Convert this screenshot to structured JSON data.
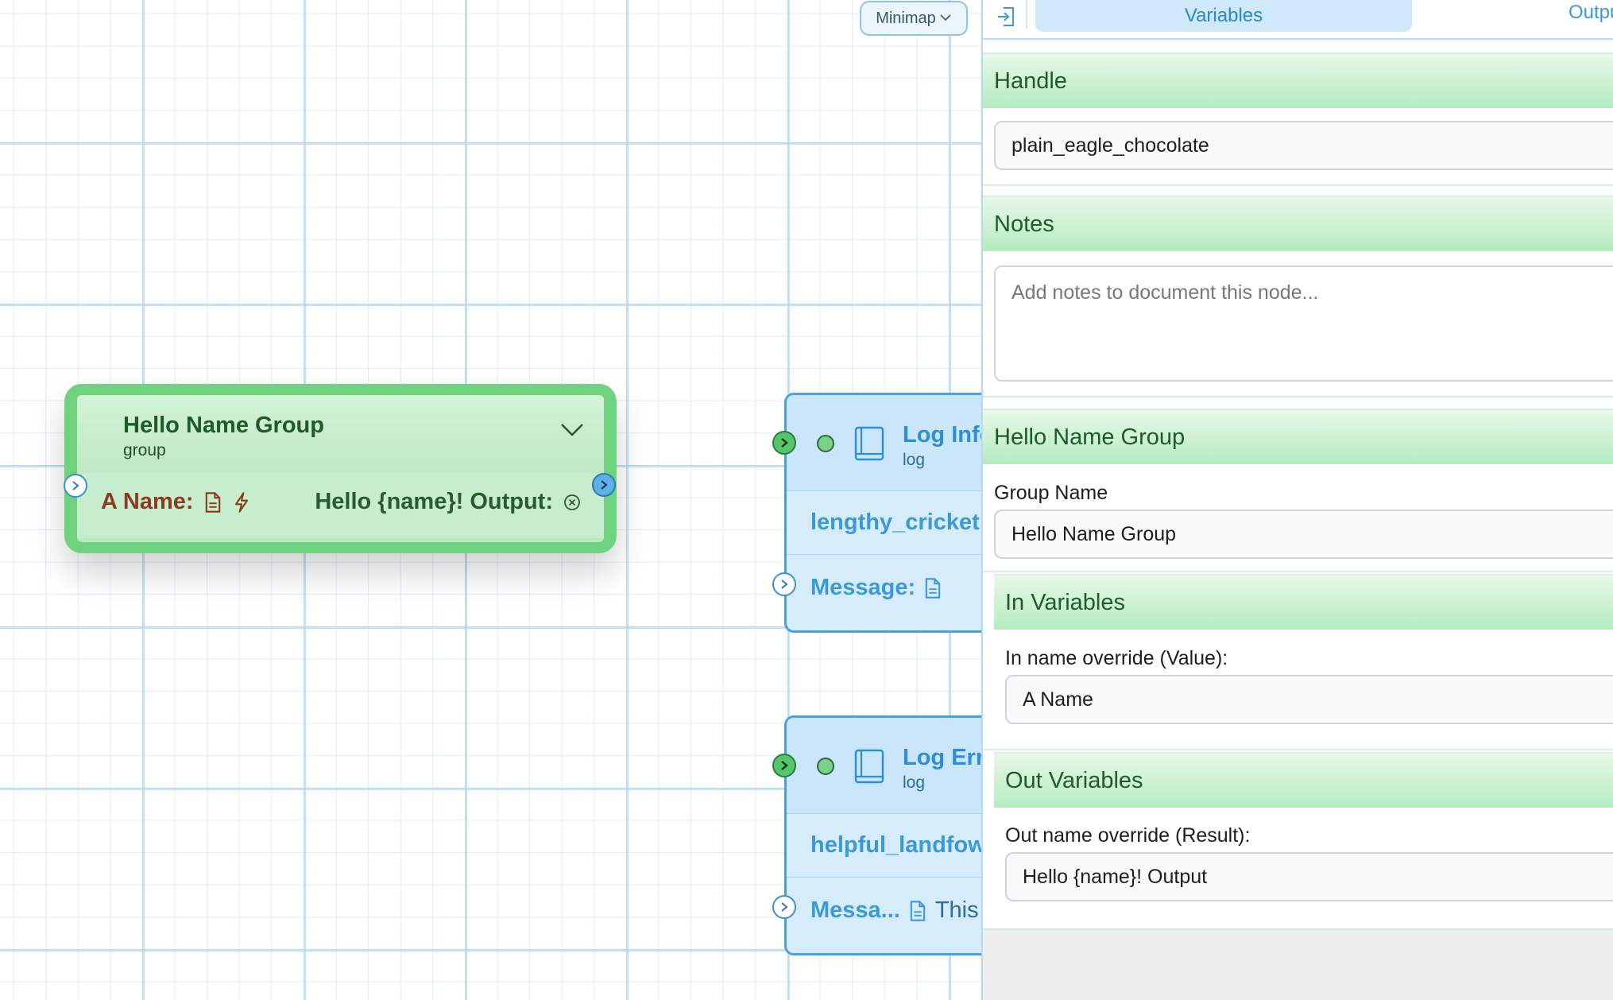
{
  "canvas": {
    "minimap_label": "Minimap",
    "group_node": {
      "title": "Hello Name Group",
      "subtitle": "group",
      "input_label": "A Name:",
      "output_label": "Hello {name}! Output:"
    },
    "log_nodes": [
      {
        "title": "Log Info",
        "type": "log",
        "handle": "lengthy_cricket",
        "message_label": "Message:",
        "message_extra": ""
      },
      {
        "title": "Log Error",
        "type": "log",
        "handle": "helpful_landfowl",
        "message_label": "Messa...",
        "message_extra": "This"
      }
    ]
  },
  "panel": {
    "tabs": {
      "variables": "Variables",
      "outputs": "Outputs"
    },
    "handle": {
      "heading": "Handle",
      "value": "plain_eagle_chocolate"
    },
    "notes": {
      "heading": "Notes",
      "placeholder": "Add notes to document this node..."
    },
    "group": {
      "heading": "Hello Name Group",
      "group_name_label": "Group Name",
      "group_name_value": "Hello Name Group",
      "in_heading": "In Variables",
      "in_label": "In name override (Value):",
      "in_value": "A Name",
      "out_heading": "Out Variables",
      "out_label": "Out name override (Result):",
      "out_value": "Hello {name}! Output"
    }
  },
  "colors": {
    "group_border": "#6fd27e",
    "log_border": "#4aa0df",
    "section_green": "#b5ebbf",
    "tab_active": "#cfe8fa"
  },
  "icons": [
    "chevron-down-icon",
    "file-icon",
    "bolt-icon",
    "close-circle-icon",
    "chevron-right-icon",
    "book-icon",
    "panel-enter-icon"
  ]
}
